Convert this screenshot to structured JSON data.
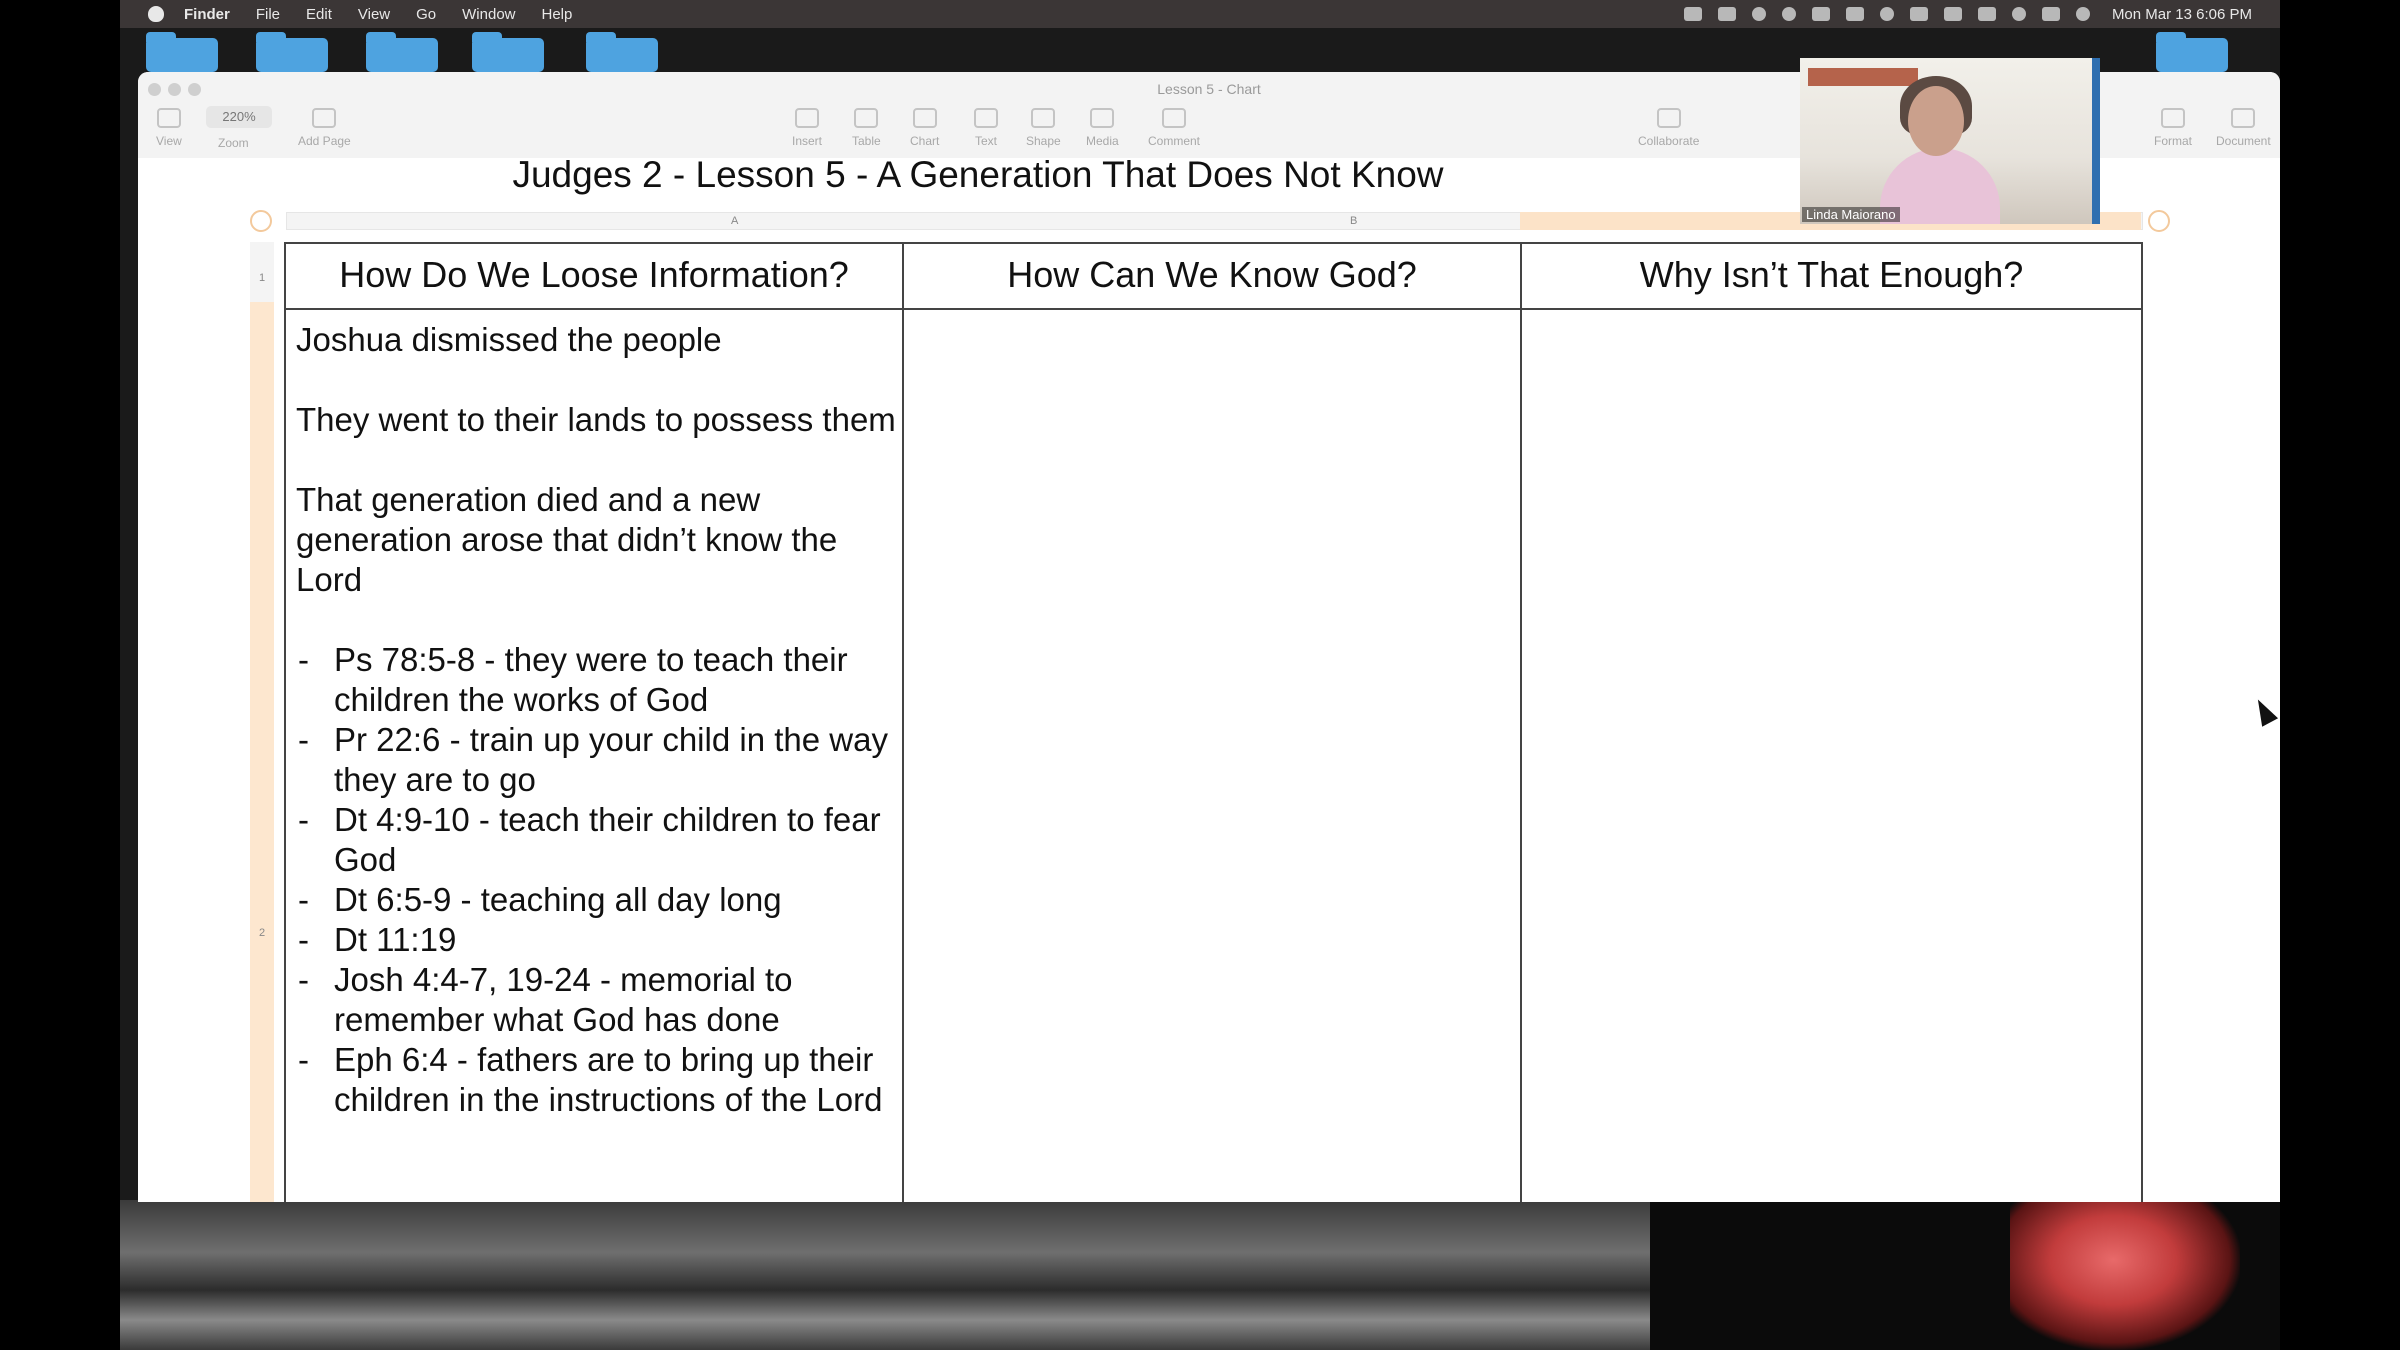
{
  "menubar": {
    "items": [
      "Finder",
      "File",
      "Edit",
      "View",
      "Go",
      "Window",
      "Help"
    ],
    "clock": "Mon Mar 13  6:06 PM"
  },
  "window": {
    "title": "Lesson 5 - Chart",
    "toolbar": {
      "zoom_value": "220%",
      "buttons": [
        "View",
        "Zoom",
        "Add Page",
        "Insert",
        "Table",
        "Chart",
        "Text",
        "Shape",
        "Media",
        "Comment",
        "Collaborate",
        "Format",
        "Document"
      ]
    }
  },
  "document": {
    "title": "Judges 2 - Lesson 5 - A Generation That Does Not Know",
    "columns": [
      "A",
      "B"
    ],
    "rows": [
      "1",
      "2"
    ],
    "headers": [
      "How Do We Loose Information?",
      "How Can We Know God?",
      "Why Isn’t That Enough?"
    ],
    "cell_a2": {
      "paragraphs": [
        "Joshua dismissed the people",
        "They went to their lands to possess them",
        "That generation died and a new generation arose that didn’t know the Lord"
      ],
      "bullets": [
        "Ps 78:5-8 - they were to teach their children the works of God",
        "Pr 22:6 - train up your child in the way they are to go",
        "Dt 4:9-10 - teach their children to fear God",
        "Dt 6:5-9 - teaching all day long",
        "Dt 11:19",
        "Josh 4:4-7, 19-24 - memorial to remember what God has done",
        "Eph 6:4 - fathers are to bring up their children in the instructions of the Lord"
      ]
    }
  },
  "video": {
    "participant_name": "Linda Maiorano"
  },
  "colors": {
    "menubar": "#3b3636",
    "folder": "#4ea3e0",
    "selection_highlight": "#fce3c8",
    "grid_line": "#444444"
  }
}
